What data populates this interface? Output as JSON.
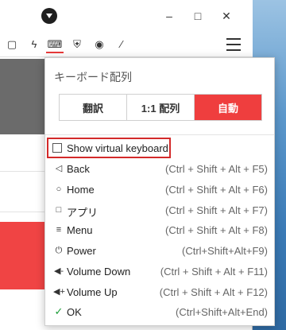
{
  "popup": {
    "title": "キーボード配列",
    "segments": [
      {
        "label": "翻訳",
        "selected": false
      },
      {
        "label": "1:1 配列",
        "selected": false
      },
      {
        "label": "自動",
        "selected": true
      }
    ],
    "show_virtual_keyboard": {
      "label": "Show virtual keyboard",
      "checked": false
    },
    "items": [
      {
        "icon": "back-icon",
        "label": "Back",
        "shortcut": "(Ctrl + Shift + Alt + F5)"
      },
      {
        "icon": "home-icon",
        "label": "Home",
        "shortcut": "(Ctrl + Shift + Alt + F6)"
      },
      {
        "icon": "apps-icon",
        "label": "アプリ",
        "shortcut": "(Ctrl + Shift + Alt + F7)"
      },
      {
        "icon": "menu-icon",
        "label": "Menu",
        "shortcut": "(Ctrl + Shift + Alt + F8)"
      },
      {
        "icon": "power-icon",
        "label": "Power",
        "shortcut": "(Ctrl+Shift+Alt+F9)"
      },
      {
        "icon": "volume-down-icon",
        "label": "Volume Down",
        "shortcut": "(Ctrl + Shift + Alt + F11)"
      },
      {
        "icon": "volume-up-icon",
        "label": "Volume Up",
        "shortcut": "(Ctrl + Shift + Alt + F12)"
      },
      {
        "icon": "ok-check-icon",
        "label": "OK",
        "shortcut": "(Ctrl+Shift+Alt+End)"
      }
    ]
  },
  "colors": {
    "accent": "#ef3e3e",
    "highlight_border": "#d32a2a",
    "ok_green": "#1b9c37"
  }
}
